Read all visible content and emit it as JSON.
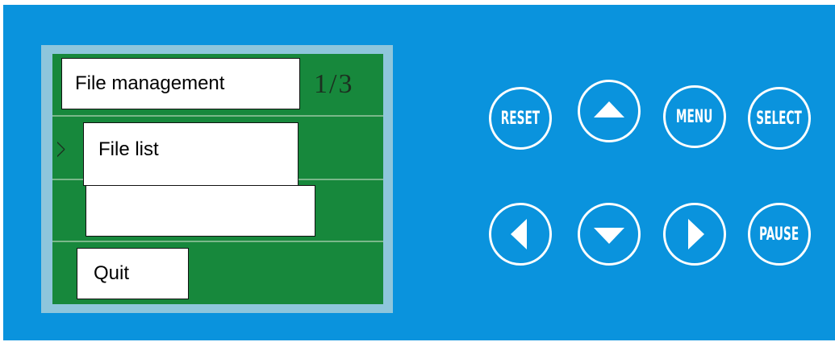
{
  "screen": {
    "title": "File    management",
    "page_indicator": "1/3",
    "cursor": ">",
    "menu_items": [
      "File list",
      "",
      "Quit"
    ]
  },
  "buttons": {
    "reset": "RESET",
    "menu": "MENU",
    "select": "SELECT",
    "pause": "PAUSE"
  },
  "colors": {
    "panel": "#0a93dd",
    "lcd": "#17883c"
  }
}
